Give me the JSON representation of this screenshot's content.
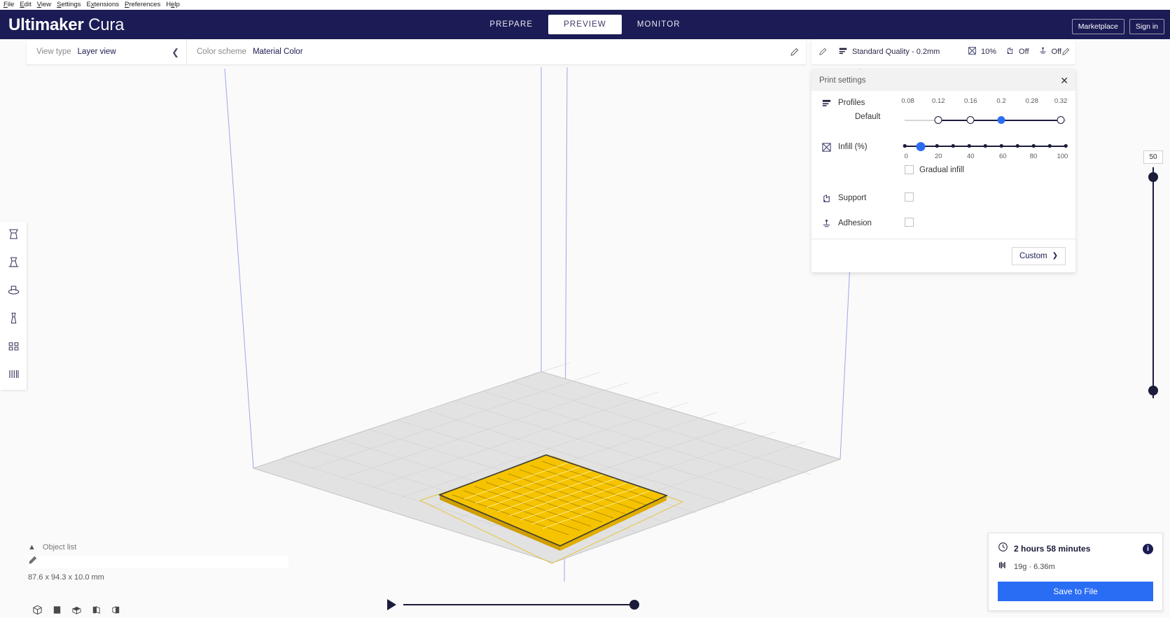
{
  "menu": {
    "items": [
      "File",
      "Edit",
      "View",
      "Settings",
      "Extensions",
      "Preferences",
      "Help"
    ]
  },
  "header": {
    "brand_bold": "Ultimaker",
    "brand_light": "Cura",
    "stages": [
      {
        "label": "PREPARE",
        "active": false
      },
      {
        "label": "PREVIEW",
        "active": true
      },
      {
        "label": "MONITOR",
        "active": false
      }
    ],
    "marketplace_label": "Marketplace",
    "signin_label": "Sign in",
    "background_color": "#1b1b55"
  },
  "view_toolbar": {
    "view_type_label": "View type",
    "view_type_value": "Layer view",
    "collapse_icon": "chevron-left-icon",
    "color_scheme_label": "Color scheme",
    "color_scheme_value": "Material Color",
    "edit_icon": "pencil-icon"
  },
  "settings_strip": {
    "left_pencil_icon": "pencil-icon",
    "profile_icon": "profile-icon",
    "profile_value": "Standard Quality - 0.2mm",
    "infill_icon": "infill-icon",
    "infill_value": "10%",
    "support_icon": "support-icon",
    "support_value": "Off",
    "adhesion_icon": "adhesion-icon",
    "adhesion_value": "Off",
    "right_pencil_icon": "pencil-icon"
  },
  "print_settings": {
    "title": "Print settings",
    "close_icon": "close-icon",
    "profiles": {
      "icon": "profile-icon",
      "label": "Profiles",
      "sub_label": "Default",
      "ticks": [
        "0.08",
        "0.12",
        "0.16",
        "0.2",
        "0.28",
        "0.32"
      ],
      "selected": "0.2",
      "selected_index": 3,
      "handle_indices": [
        1,
        2,
        3,
        5
      ],
      "accent_color": "#2a6df5"
    },
    "infill": {
      "icon": "infill-icon",
      "label": "Infill (%)",
      "ticks": [
        "0",
        "20",
        "40",
        "60",
        "80",
        "100"
      ],
      "value": 10,
      "gradual_label": "Gradual infill",
      "gradual_checked": false
    },
    "support": {
      "icon": "support-icon",
      "label": "Support",
      "checked": false
    },
    "adhesion": {
      "icon": "adhesion-icon",
      "label": "Adhesion",
      "checked": false
    },
    "custom_label": "Custom",
    "custom_icon": "chevron-right-icon"
  },
  "left_toolbar": {
    "items": [
      {
        "name": "move-tool",
        "icon": "move-icon"
      },
      {
        "name": "scale-tool",
        "icon": "scale-icon"
      },
      {
        "name": "rotate-tool",
        "icon": "rotate-icon"
      },
      {
        "name": "mirror-tool",
        "icon": "mirror-icon"
      },
      {
        "name": "per-model-settings-tool",
        "icon": "per-model-icon"
      },
      {
        "name": "support-blocker-tool",
        "icon": "support-blocker-icon"
      }
    ]
  },
  "layer_slider": {
    "value": "50",
    "handle_position_pct": 96
  },
  "scrubber": {
    "play_icon": "play-icon",
    "position_pct": 100
  },
  "object_list": {
    "caret_icon": "chevron-up-icon",
    "label": "Object list",
    "row_icon": "pencil-icon",
    "row_value": "",
    "dimensions": "87.6 x 94.3 x 10.0 mm"
  },
  "bottom_icons": [
    {
      "name": "view-3d-icon"
    },
    {
      "name": "view-front-icon"
    },
    {
      "name": "view-top-icon"
    },
    {
      "name": "view-left-icon"
    },
    {
      "name": "view-right-icon"
    }
  ],
  "print_info": {
    "time_icon": "clock-icon",
    "time": "2 hours 58 minutes",
    "material_icon": "material-icon",
    "material": "19g · 6.36m",
    "info_icon": "info-icon",
    "save_label": "Save to File",
    "save_color": "#2a6df5"
  },
  "build_plate": {
    "model_color": "#ffc400",
    "outline_color": "#7a86e8"
  }
}
